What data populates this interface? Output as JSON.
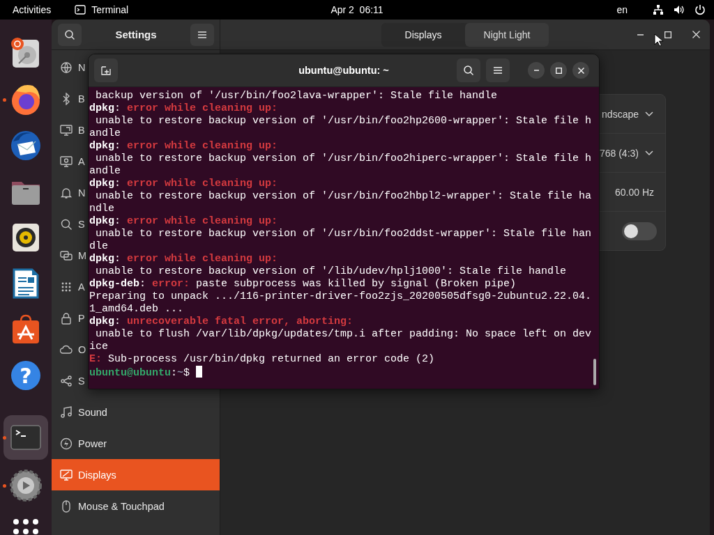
{
  "top_bar": {
    "activities": "Activities",
    "app_name": "Terminal",
    "clock": "Apr 2  06:11",
    "input_source": "en"
  },
  "dock": [
    {
      "kind": "installer",
      "running": false,
      "selected": false
    },
    {
      "kind": "browser",
      "running": true,
      "selected": false
    },
    {
      "kind": "mail",
      "running": false,
      "selected": false
    },
    {
      "kind": "files",
      "running": false,
      "selected": false
    },
    {
      "kind": "music",
      "running": false,
      "selected": false
    },
    {
      "kind": "writer",
      "running": false,
      "selected": false
    },
    {
      "kind": "store",
      "running": false,
      "selected": false
    },
    {
      "kind": "help",
      "running": false,
      "selected": false,
      "glyph": "?"
    },
    {
      "kind": "separator"
    },
    {
      "kind": "terminal",
      "running": true,
      "selected": true
    },
    {
      "kind": "settings",
      "running": true,
      "selected": false
    },
    {
      "kind": "apps",
      "running": false,
      "selected": false
    }
  ],
  "settings": {
    "title": "Settings",
    "tabs": [
      {
        "label": "Displays",
        "selected": true
      },
      {
        "label": "Night Light",
        "selected": false
      }
    ],
    "sidebar": [
      {
        "kind": "network",
        "label": "N",
        "selected": false
      },
      {
        "kind": "bluetooth",
        "label": "B",
        "selected": false
      },
      {
        "kind": "background",
        "label": "B",
        "selected": false
      },
      {
        "kind": "appearance",
        "label": "A",
        "selected": false
      },
      {
        "kind": "notifications",
        "label": "N",
        "selected": false
      },
      {
        "kind": "search",
        "label": "S",
        "selected": false
      },
      {
        "kind": "multitasking",
        "label": "M",
        "selected": false
      },
      {
        "kind": "apps",
        "label": "A",
        "selected": false
      },
      {
        "kind": "privacy",
        "label": "P",
        "selected": false
      },
      {
        "kind": "online",
        "label": "O",
        "selected": false
      },
      {
        "kind": "sharing",
        "label": "S",
        "selected": false
      },
      {
        "kind": "sound",
        "label": "Sound",
        "selected": false
      },
      {
        "kind": "power",
        "label": "Power",
        "selected": false
      },
      {
        "kind": "displays",
        "label": "Displays",
        "selected": true
      },
      {
        "kind": "mouse",
        "label": "Mouse & Touchpad",
        "selected": false
      }
    ],
    "display_rows": [
      {
        "kind": "dropdown",
        "value": "ndscape"
      },
      {
        "kind": "dropdown",
        "value": "768 (4:3)"
      },
      {
        "kind": "text",
        "value": "60.00 Hz"
      },
      {
        "kind": "switch",
        "on": false
      }
    ]
  },
  "terminal": {
    "title": "ubuntu@ubuntu: ~",
    "cursor": true,
    "lines": [
      [
        {
          "kind": "plain",
          "text": " backup version of '/usr/bin/foo2lava-wrapper': Stale file handle"
        }
      ],
      [
        {
          "kind": "bold",
          "text": "dpkg"
        },
        {
          "kind": "plain",
          "text": ": "
        },
        {
          "kind": "error",
          "text": "error while cleaning up:"
        }
      ],
      [
        {
          "kind": "plain",
          "text": " unable to restore backup version of '/usr/bin/foo2hp2600-wrapper': Stale file h"
        }
      ],
      [
        {
          "kind": "plain",
          "text": "andle"
        }
      ],
      [
        {
          "kind": "bold",
          "text": "dpkg"
        },
        {
          "kind": "plain",
          "text": ": "
        },
        {
          "kind": "error",
          "text": "error while cleaning up:"
        }
      ],
      [
        {
          "kind": "plain",
          "text": " unable to restore backup version of '/usr/bin/foo2hiperc-wrapper': Stale file h"
        }
      ],
      [
        {
          "kind": "plain",
          "text": "andle"
        }
      ],
      [
        {
          "kind": "bold",
          "text": "dpkg"
        },
        {
          "kind": "plain",
          "text": ": "
        },
        {
          "kind": "error",
          "text": "error while cleaning up:"
        }
      ],
      [
        {
          "kind": "plain",
          "text": " unable to restore backup version of '/usr/bin/foo2hbpl2-wrapper': Stale file ha"
        }
      ],
      [
        {
          "kind": "plain",
          "text": "ndle"
        }
      ],
      [
        {
          "kind": "bold",
          "text": "dpkg"
        },
        {
          "kind": "plain",
          "text": ": "
        },
        {
          "kind": "error",
          "text": "error while cleaning up:"
        }
      ],
      [
        {
          "kind": "plain",
          "text": " unable to restore backup version of '/usr/bin/foo2ddst-wrapper': Stale file han"
        }
      ],
      [
        {
          "kind": "plain",
          "text": "dle"
        }
      ],
      [
        {
          "kind": "bold",
          "text": "dpkg"
        },
        {
          "kind": "plain",
          "text": ": "
        },
        {
          "kind": "error",
          "text": "error while cleaning up:"
        }
      ],
      [
        {
          "kind": "plain",
          "text": " unable to restore backup version of '/lib/udev/hplj1000': Stale file handle"
        }
      ],
      [
        {
          "kind": "bold",
          "text": "dpkg-deb"
        },
        {
          "kind": "plain",
          "text": ": "
        },
        {
          "kind": "error",
          "text": "error:"
        },
        {
          "kind": "plain",
          "text": " paste subprocess was killed by signal (Broken pipe)"
        }
      ],
      [
        {
          "kind": "plain",
          "text": "Preparing to unpack .../116-printer-driver-foo2zjs_20200505dfsg0-2ubuntu2.22.04."
        }
      ],
      [
        {
          "kind": "plain",
          "text": "1_amd64.deb ..."
        }
      ],
      [
        {
          "kind": "bold",
          "text": "dpkg"
        },
        {
          "kind": "plain",
          "text": ": "
        },
        {
          "kind": "error",
          "text": "unrecoverable fatal error, aborting:"
        }
      ],
      [
        {
          "kind": "plain",
          "text": " unable to flush /var/lib/dpkg/updates/tmp.i after padding: No space left on dev"
        }
      ],
      [
        {
          "kind": "plain",
          "text": "ice"
        }
      ],
      [
        {
          "kind": "error",
          "text": "E:"
        },
        {
          "kind": "plain",
          "text": " Sub-process /usr/bin/dpkg returned an error code (2)"
        }
      ],
      [
        {
          "kind": "host",
          "text": "ubuntu@ubuntu"
        },
        {
          "kind": "plain",
          "text": ":"
        },
        {
          "kind": "path",
          "text": "~"
        },
        {
          "kind": "plain",
          "text": "$ "
        }
      ]
    ]
  }
}
